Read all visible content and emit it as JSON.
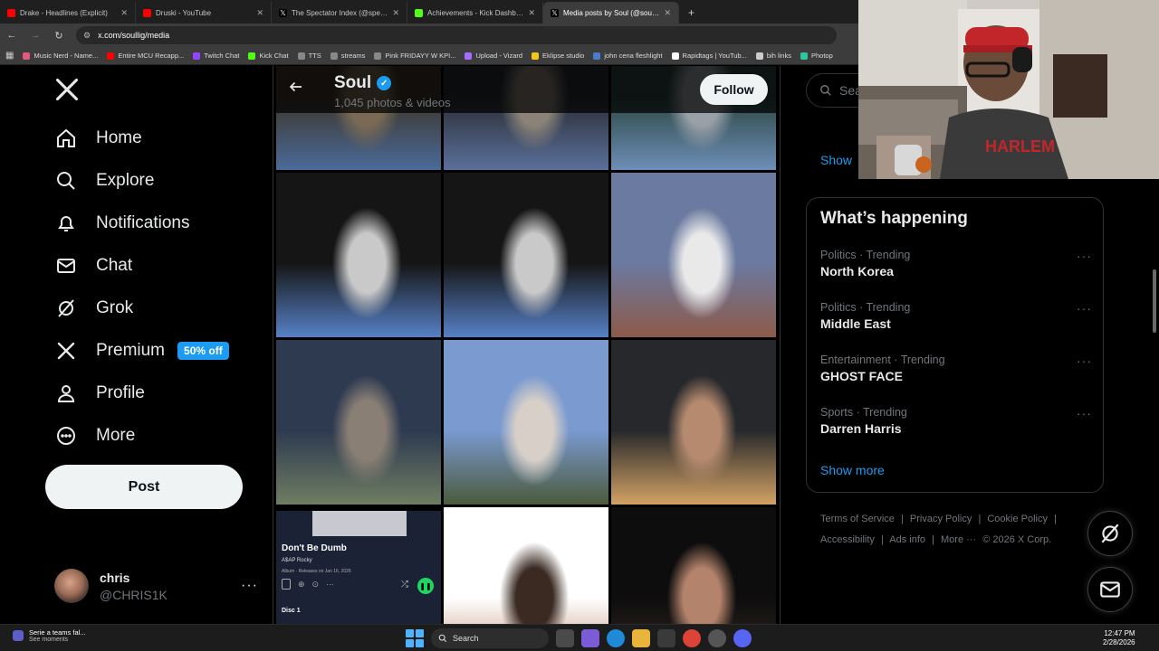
{
  "browser": {
    "tabs": [
      {
        "title": "Drake - Headlines (Explicit)",
        "favicon_color": "#ff0000",
        "active": false
      },
      {
        "title": "Druski - YouTube",
        "favicon_color": "#ff0000",
        "active": false
      },
      {
        "title": "The Spectator Index (@spectat",
        "favicon_color": "#ffffff",
        "active": false
      },
      {
        "title": "Achievements - Kick Dashboard",
        "favicon_color": "#53fc18",
        "active": false
      },
      {
        "title": "Media posts by Soul (@soullig",
        "favicon_color": "#ffffff",
        "active": true
      }
    ],
    "new_tab_label": "+",
    "url": "x.com/soullig/media",
    "bookmarks": [
      {
        "label": "Music Nerd - Name...",
        "color": "#e05a7a"
      },
      {
        "label": "Entire MCU Recapp...",
        "color": "#ff0000"
      },
      {
        "label": "Twitch Chat",
        "color": "#9146ff"
      },
      {
        "label": "Kick Chat",
        "color": "#53fc18"
      },
      {
        "label": "TTS",
        "color": "#888888"
      },
      {
        "label": "streams",
        "color": "#888888"
      },
      {
        "label": "Pink FRIDAYY W KPI...",
        "color": "#888888"
      },
      {
        "label": "Upload - Vizard",
        "color": "#a66bff"
      },
      {
        "label": "Eklipse studio",
        "color": "#f5c518"
      },
      {
        "label": "john cena fleshlight",
        "color": "#4a7bd0"
      },
      {
        "label": "Rapidtags | YouTub...",
        "color": "#ffffff"
      },
      {
        "label": "bih links",
        "color": "#cccccc"
      },
      {
        "label": "Photop",
        "color": "#31c4a0"
      }
    ]
  },
  "sidebar": {
    "items": [
      {
        "label": "Home",
        "icon": "home-icon"
      },
      {
        "label": "Explore",
        "icon": "search-icon"
      },
      {
        "label": "Notifications",
        "icon": "bell-icon"
      },
      {
        "label": "Chat",
        "icon": "mail-icon"
      },
      {
        "label": "Grok",
        "icon": "grok-icon"
      },
      {
        "label": "Premium",
        "icon": "x-icon",
        "badge": "50% off"
      },
      {
        "label": "Profile",
        "icon": "person-icon"
      },
      {
        "label": "More",
        "icon": "more-circle-icon"
      }
    ],
    "post_label": "Post",
    "account": {
      "name": "chris",
      "handle": "@CHRIS1K",
      "more": "···"
    }
  },
  "profile": {
    "name": "Soul",
    "subtitle": "1,045 photos & videos",
    "follow_label": "Follow",
    "back_icon": "arrow-left-icon"
  },
  "media_tiles": [
    {
      "row": 0,
      "col": 0,
      "palette": [
        "#3d3428",
        "#7a6a55",
        "#4a6b9a"
      ]
    },
    {
      "row": 0,
      "col": 1,
      "palette": [
        "#2a2d33",
        "#8b8378",
        "#5a6f9a"
      ]
    },
    {
      "row": 0,
      "col": 2,
      "palette": [
        "#2b4640",
        "#9aa0a8",
        "#6d8fb8"
      ]
    },
    {
      "row": 1,
      "col": 0,
      "palette": [
        "#151515",
        "#c9c9c9",
        "#5681c7"
      ]
    },
    {
      "row": 1,
      "col": 1,
      "palette": [
        "#151515",
        "#c9c9c9",
        "#5681c7"
      ]
    },
    {
      "row": 1,
      "col": 2,
      "palette": [
        "#6b7aa0",
        "#e9e9e9",
        "#8c5a4a"
      ]
    },
    {
      "row": 2,
      "col": 0,
      "palette": [
        "#2e3a50",
        "#8a7f75",
        "#6e7d62"
      ]
    },
    {
      "row": 2,
      "col": 1,
      "palette": [
        "#7a9ad0",
        "#d8d0c8",
        "#4b5a3c"
      ]
    },
    {
      "row": 2,
      "col": 2,
      "palette": [
        "#26282b",
        "#b58a6e",
        "#d3a264"
      ]
    },
    {
      "row": 3,
      "col": 0,
      "palette": [
        "#1a1d2a",
        "#2a2f48",
        "#d33b3b"
      ]
    },
    {
      "row": 3,
      "col": 1,
      "palette": [
        "#ffffff",
        "#3a2a22",
        "#c08b70"
      ]
    },
    {
      "row": 3,
      "col": 2,
      "palette": [
        "#0d0d0d",
        "#b4836b",
        "#3a2a24"
      ]
    }
  ],
  "spotify_tile": {
    "title": "Don't Be Dumb",
    "artist": "A$AP Rocky",
    "meta": "Album · Releases on Jan 16, 2026",
    "disc": "Disc 1"
  },
  "right": {
    "search_placeholder": "Sear",
    "show_top_label": "Show",
    "happening_title": "What’s happening",
    "trends": [
      {
        "category": "Politics · Trending",
        "name": "North Korea"
      },
      {
        "category": "Politics · Trending",
        "name": "Middle East"
      },
      {
        "category": "Entertainment · Trending",
        "name": "GHOST FACE"
      },
      {
        "category": "Sports · Trending",
        "name": "Darren Harris"
      }
    ],
    "trend_more": "···",
    "show_more_label": "Show more",
    "footer": [
      "Terms of Service",
      "|",
      "Privacy Policy",
      "|",
      "Cookie Policy",
      "|",
      "Accessibility",
      "|",
      "Ads info",
      "|",
      "More ···",
      "© 2026 X Corp."
    ]
  },
  "taskbar": {
    "notification_title": "Serie a teams fal...",
    "notification_sub": "See moments",
    "search_label": "Search",
    "time": "12:47 PM",
    "date": "2/28/2026"
  },
  "colors": {
    "accent": "#1d9bf0",
    "text_primary": "#e7e9ea",
    "text_secondary": "#71767b",
    "border": "#2f3336"
  }
}
